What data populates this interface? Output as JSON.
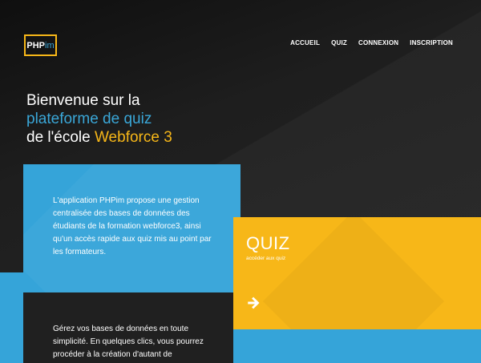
{
  "brand": {
    "logo_part1": "PHP",
    "logo_part2": "im"
  },
  "nav": {
    "items": [
      "ACCUEIL",
      "QUIZ",
      "CONNEXION",
      "INSCRIPTION"
    ]
  },
  "hero": {
    "line1": "Bienvenue sur la",
    "line2": "plateforme de quiz",
    "line3_prefix": "de l'école ",
    "line3_highlight": "Webforce 3"
  },
  "intro_text": "L'application PHPim propose une gestion centralisée des bases de données des étudiants de la formation webforce3, ainsi qu'un accès rapide aux quiz mis au point par les formateurs.",
  "secondary_text": "Gérez vos bases de données en toute simplicité. En quelques clics, vous pourrez procéder à la création d'autant de",
  "quiz_card": {
    "title": "QUIZ",
    "subtitle": "accéder aux quiz",
    "icon": "arrow-right-icon"
  },
  "colors": {
    "accent_blue": "#35a4d9",
    "accent_yellow": "#f7b718",
    "background": "#1c1c1c"
  }
}
